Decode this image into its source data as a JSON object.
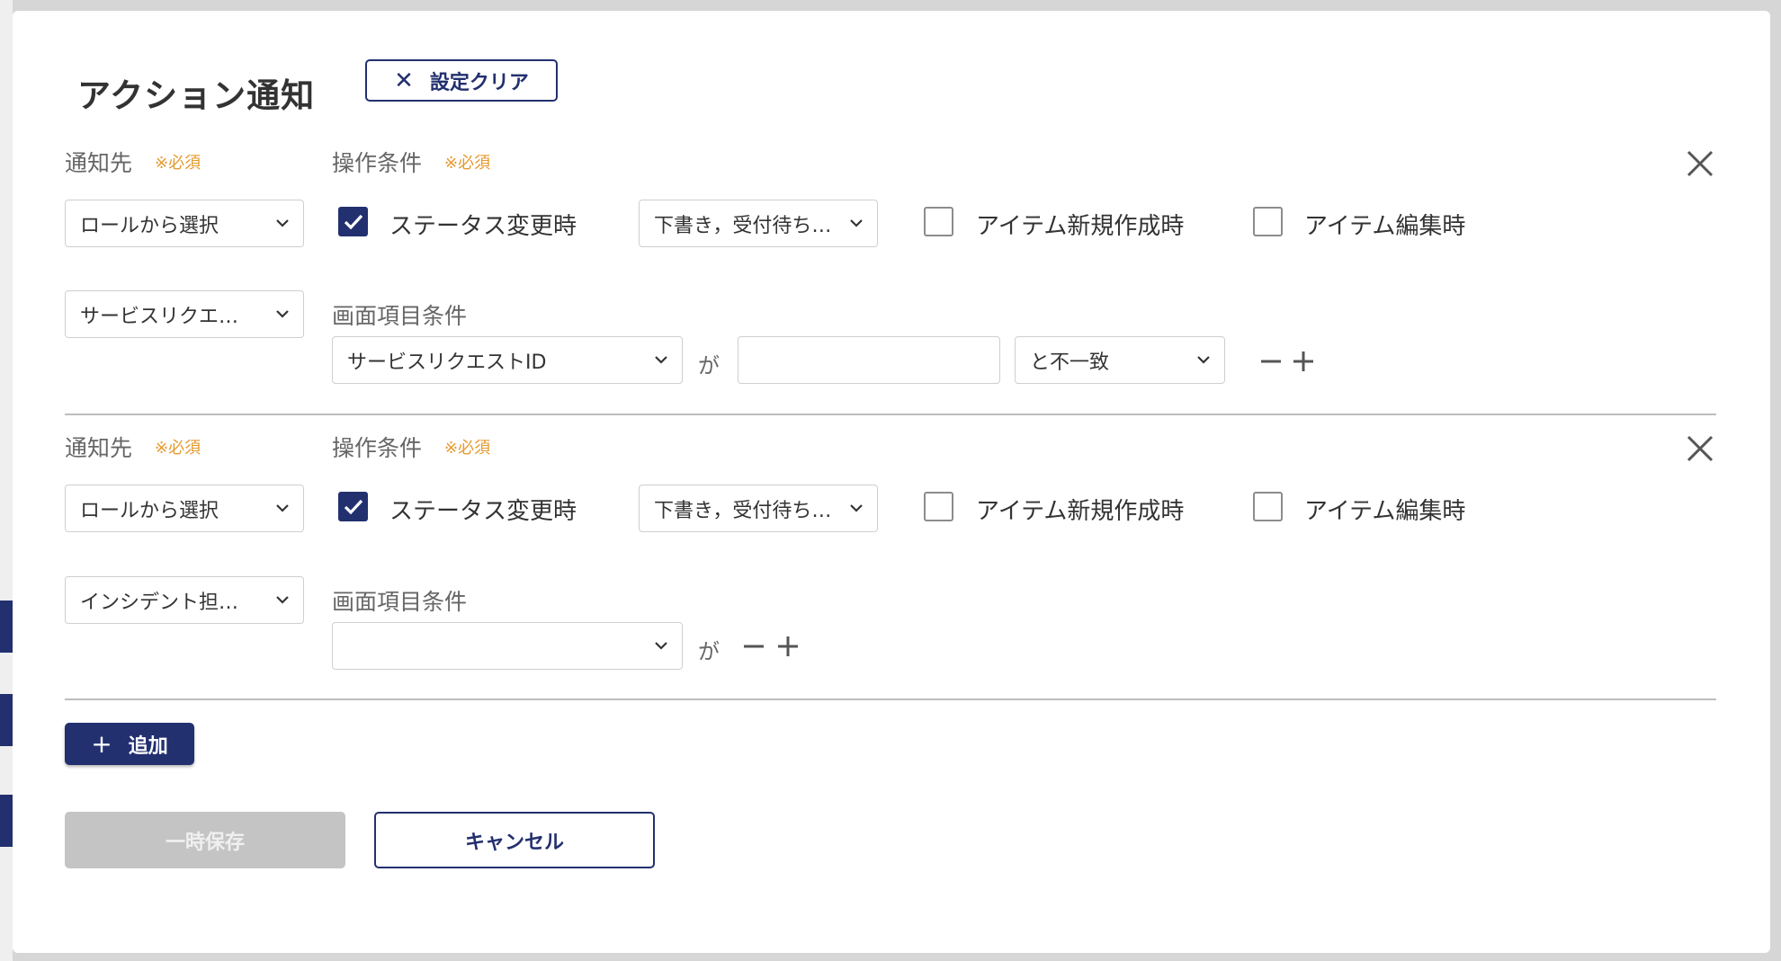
{
  "modal": {
    "title": "アクション通知",
    "clear_label": "設定クリア"
  },
  "rules": [
    {
      "recipient_label": "通知先",
      "required_mark": "※必須",
      "condition_label": "操作条件",
      "recipient_type": "ロールから選択",
      "recipient_value": "サービスリクエ…",
      "status_change_label": "ステータス変更時",
      "status_change_checked": true,
      "status_value": "下書き，受付待ち…",
      "new_item_label": "アイテム新規作成時",
      "new_item_checked": false,
      "edit_item_label": "アイテム編集時",
      "edit_item_checked": false,
      "field_condition_label": "画面項目条件",
      "field_select": "サービスリクエストID",
      "ga": "が",
      "field_value": "",
      "match_operator": "と不一致"
    },
    {
      "recipient_label": "通知先",
      "required_mark": "※必須",
      "condition_label": "操作条件",
      "recipient_type": "ロールから選択",
      "recipient_value": "インシデント担…",
      "status_change_label": "ステータス変更時",
      "status_change_checked": true,
      "status_value": "下書き，受付待ち…",
      "new_item_label": "アイテム新規作成時",
      "new_item_checked": false,
      "edit_item_label": "アイテム編集時",
      "edit_item_checked": false,
      "field_condition_label": "画面項目条件",
      "field_select": "",
      "ga": "が"
    }
  ],
  "actions": {
    "add_label": "追加",
    "save_label": "一時保存",
    "cancel_label": "キャンセル"
  },
  "colors": {
    "primary": "#23306f",
    "required": "#e69a2e",
    "disabled": "#c4c4c4"
  }
}
